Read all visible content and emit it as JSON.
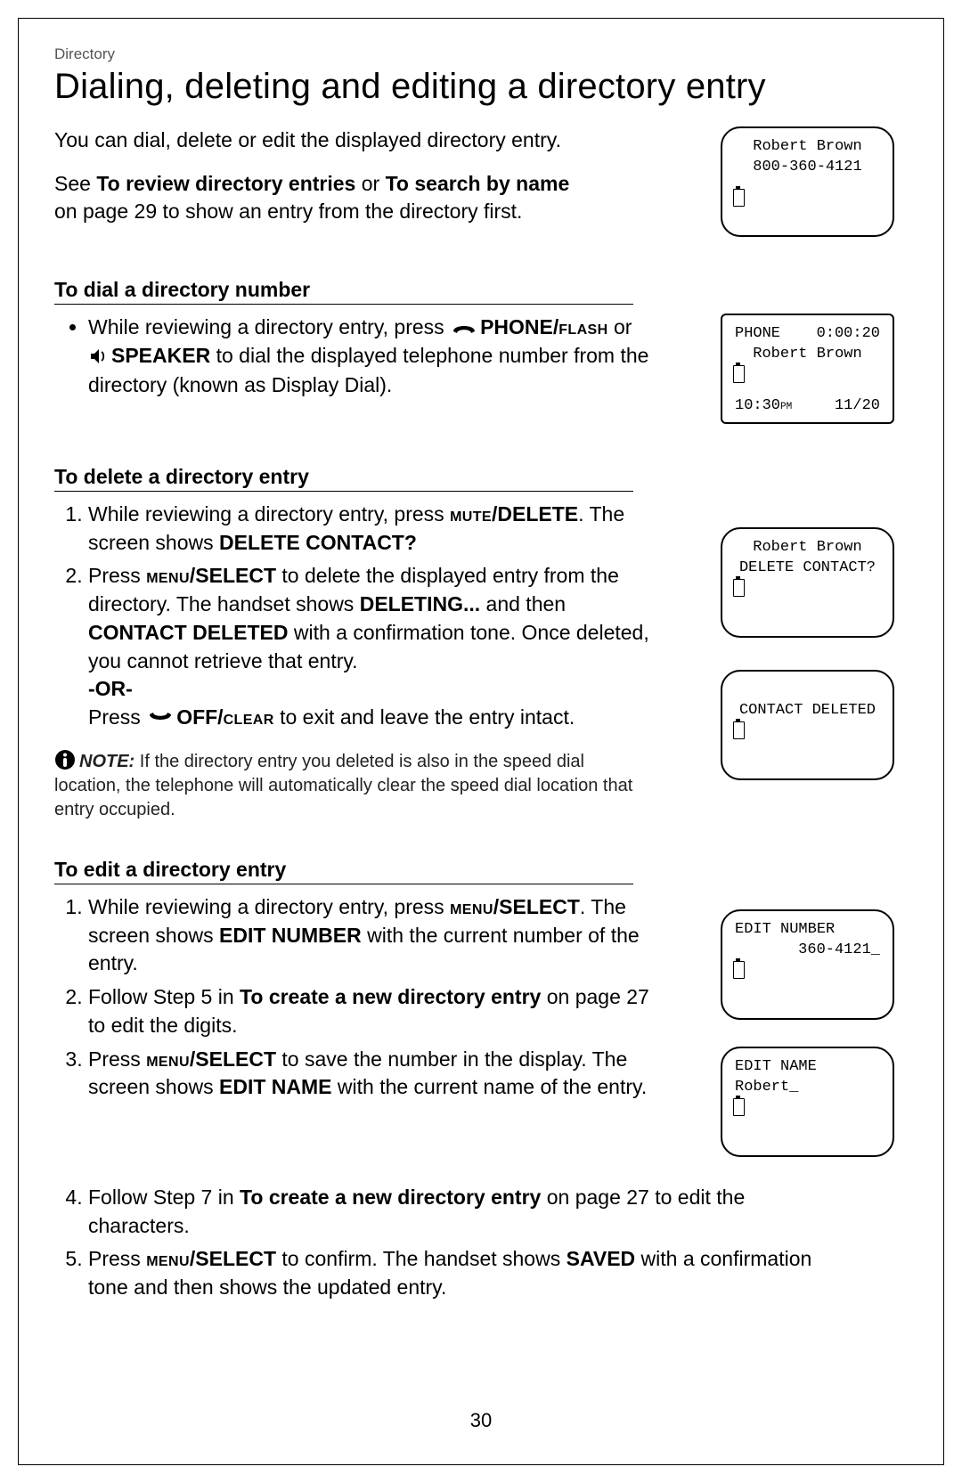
{
  "breadcrumb": "Directory",
  "title": "Dialing, deleting and editing a directory entry",
  "intro": "You can dial, delete or edit the displayed directory entry.",
  "see_also_pre": "See ",
  "see_also_b1": "To review directory entries",
  "see_also_mid": " or ",
  "see_also_b2": "To search by name",
  "see_also_post": " on page 29 to show an entry from the directory first.",
  "sec1_head": "To dial a directory number",
  "sec1_item_a": "While reviewing a directory entry, press ",
  "sec1_phone": "PHONE/",
  "sec1_flash": "FLASH",
  "sec1_item_b": " or ",
  "sec1_speaker": "SPEAKER",
  "sec1_item_c": " to dial the displayed telephone number from the directory (known as Display Dial).",
  "sec2_head": "To delete a directory entry",
  "sec2_s1_a": "While reviewing a directory entry, press ",
  "sec2_mute": "MUTE",
  "sec2_delete": "/DELETE",
  "sec2_s1_b": ". The screen shows ",
  "sec2_delq": "DELETE CONTACT?",
  "sec2_s2_a": "Press ",
  "sec2_menu": "MENU",
  "sec2_select": "/SELECT",
  "sec2_s2_b": " to delete the displayed entry from the directory. The handset shows ",
  "sec2_deleting": "DELETING...",
  "sec2_s2_c": " and then ",
  "sec2_contdel": "CONTACT DELETED",
  "sec2_s2_d": " with a confirmation tone. Once deleted, you cannot retrieve that entry.",
  "sec2_or": "-OR-",
  "sec2_s2_e": "Press ",
  "sec2_off": "OFF/",
  "sec2_clear": "CLEAR",
  "sec2_s2_f": " to exit and leave the entry intact.",
  "note_label": "NOTE:",
  "note_body": " If the directory entry you deleted is also in the speed dial location, the telephone will automatically clear the speed dial location that entry occupied.",
  "sec3_head": "To edit a directory entry",
  "sec3_s1_a": "While reviewing a directory entry, press ",
  "sec3_s1_b": ". The screen shows ",
  "sec3_editnum": "EDIT NUMBER",
  "sec3_s1_c": " with the current number of the entry.",
  "sec3_s2_a": "Follow Step 5 in ",
  "sec3_create": "To create a new directory entry",
  "sec3_s2_b": " on page 27 to edit the digits.",
  "sec3_s3_a": "Press ",
  "sec3_s3_b": " to save the number in the display. The screen shows ",
  "sec3_editname": "EDIT NAME",
  "sec3_s3_c": " with the current name of the entry.",
  "sec3_s4_a": "Follow Step 7 in ",
  "sec3_s4_b": " on page 27 to edit the characters.",
  "sec3_s5_a": "Press ",
  "sec3_s5_b": " to confirm. The handset shows ",
  "sec3_saved": "SAVED",
  "sec3_s5_c": " with a confirmation tone and then shows the updated entry.",
  "lcd1_l1": "Robert Brown",
  "lcd1_l2": "800-360-4121",
  "lcd2_l1a": "PHONE",
  "lcd2_l1b": "0:00:20",
  "lcd2_l2": "Robert Brown",
  "lcd2_l3a": "10:30",
  "lcd2_l3am": "PM",
  "lcd2_l3b": "11/20",
  "lcd3_l1": "Robert Brown",
  "lcd3_l2": "DELETE CONTACT?",
  "lcd4_l1": "CONTACT DELETED",
  "lcd5_l1": "EDIT NUMBER",
  "lcd5_l2": "360-4121_",
  "lcd6_l1": "EDIT NAME",
  "lcd6_l2": "Robert_",
  "pagenum": "30"
}
